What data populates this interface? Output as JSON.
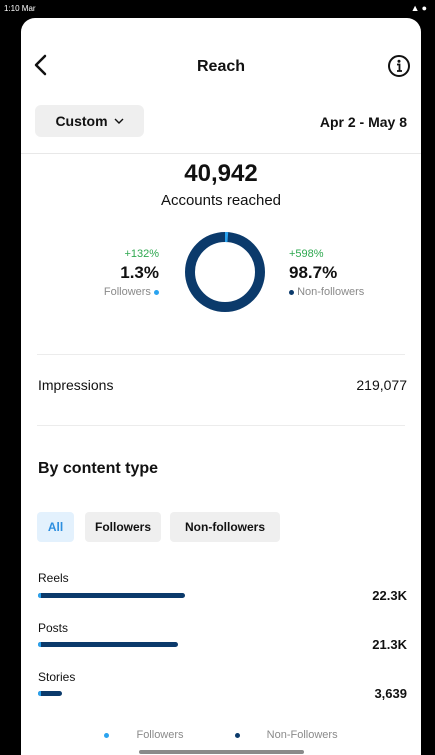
{
  "status": {
    "time": "1:10 Mar"
  },
  "header": {
    "title": "Reach"
  },
  "range": {
    "selector_label": "Custom",
    "dates": "Apr 2 - May 8"
  },
  "summary": {
    "accounts_reached": "40,942",
    "accounts_reached_label": "Accounts reached",
    "followers": {
      "change": "+132%",
      "percent": "1.3%",
      "label": "Followers",
      "fraction": 0.013
    },
    "non_followers": {
      "change": "+598%",
      "percent": "98.7%",
      "label": "Non-followers",
      "fraction": 0.987
    }
  },
  "impressions": {
    "label": "Impressions",
    "value": "219,077"
  },
  "content_type": {
    "title": "By content type",
    "filters": [
      "All",
      "Followers",
      "Non-followers"
    ],
    "active_filter": "All",
    "items": [
      {
        "label": "Reels",
        "value": "22.3K",
        "amount": 22300
      },
      {
        "label": "Posts",
        "value": "21.3K",
        "amount": 21300
      },
      {
        "label": "Stories",
        "value": "3,639",
        "amount": 3639
      }
    ],
    "legend": {
      "followers": "Followers",
      "non_followers": "Non-Followers"
    }
  },
  "colors": {
    "followers": "#2aa3ef",
    "non_followers": "#0b3a6b",
    "positive_change": "#2ea84f"
  },
  "icons": {
    "back": "chevron-left-icon",
    "info": "info-circle-icon",
    "dropdown": "chevron-down-icon"
  }
}
